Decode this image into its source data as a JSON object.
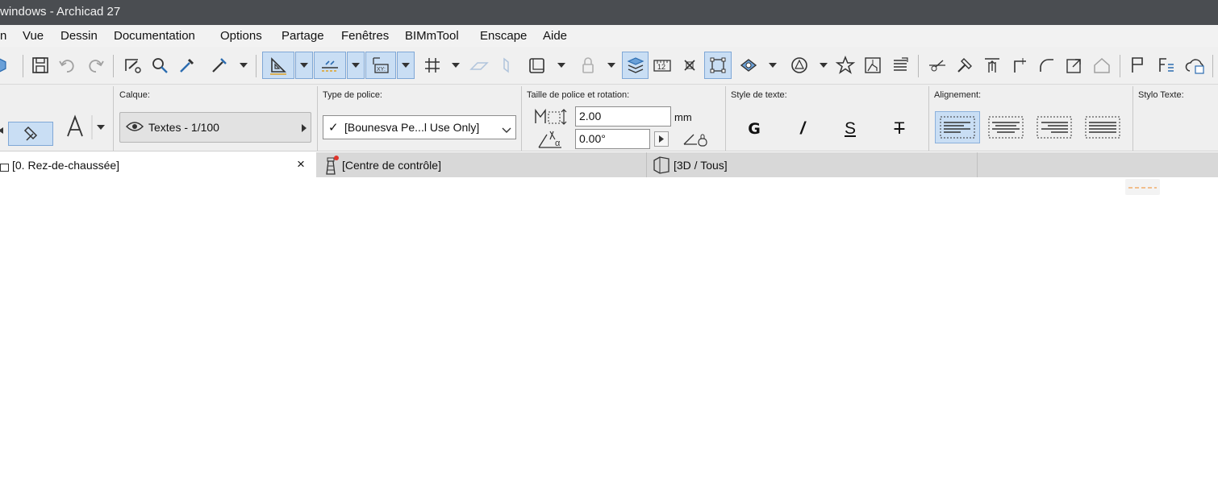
{
  "window": {
    "title": "windows - Archicad 27"
  },
  "menu": {
    "items": [
      "n",
      "Vue",
      "Dessin",
      "Documentation",
      "Options",
      "Partage",
      "Fenêtres",
      "BIMmTool",
      "Enscape",
      "Aide"
    ]
  },
  "infobox": {
    "layer": {
      "label": "Calque:",
      "value": "Textes - 1/100"
    },
    "font": {
      "label": "Type de police:",
      "value": "[Bounesva Pe...l Use Only]",
      "check": "✓"
    },
    "size_rotation": {
      "label": "Taille de police et rotation:",
      "size": "2.00",
      "unit": "mm",
      "rotation": "0.00°"
    },
    "text_style": {
      "label": "Style de texte:",
      "bold": "G",
      "italic": "/",
      "underline": "S",
      "strike": "T"
    },
    "alignment": {
      "label": "Alignement:"
    },
    "pen": {
      "label": "Stylo Texte:"
    }
  },
  "tabs": [
    {
      "label": "[0. Rez-de-chaussée]",
      "close": "×"
    },
    {
      "label": "[Centre de contrôle]"
    },
    {
      "label": "[3D / Tous]"
    }
  ],
  "colors": {
    "titlebar": "#4a4d51",
    "selected": "#c9def4",
    "accent": "#2b6cb0"
  }
}
